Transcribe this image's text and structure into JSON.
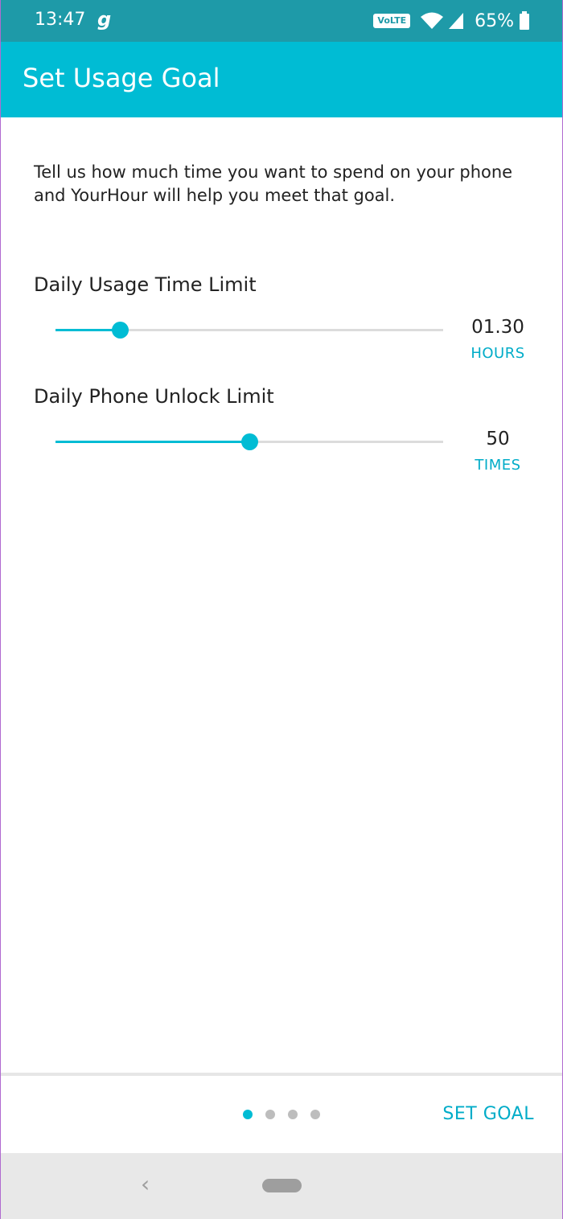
{
  "status_bar": {
    "time": "13:47",
    "notification_glyph": "g",
    "volte": "VoLTE",
    "battery": "65%"
  },
  "app_bar": {
    "title": "Set Usage Goal"
  },
  "description": "Tell us how much time you want to spend on your phone and YourHour will help you meet that goal.",
  "usage_limit": {
    "label": "Daily Usage Time Limit",
    "value": "01.30",
    "unit": "HOURS",
    "slider_fraction": 0.167
  },
  "unlock_limit": {
    "label": "Daily Phone Unlock Limit",
    "value": "50",
    "unit": "TIMES",
    "slider_fraction": 0.5
  },
  "pager": {
    "count": 4,
    "active": 0
  },
  "footer": {
    "set_goal_label": "SET GOAL"
  },
  "colors": {
    "accent": "#00bcd4",
    "status_bar": "#1e9aa8",
    "track": "#dcdcdc"
  },
  "icons": [
    "wifi-icon",
    "signal-icon",
    "battery-icon",
    "back-icon",
    "home-icon"
  ]
}
